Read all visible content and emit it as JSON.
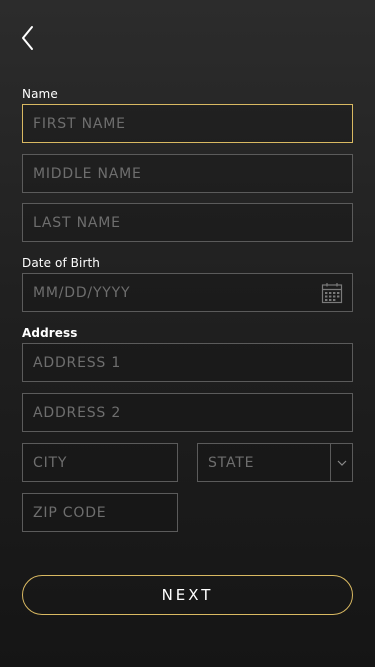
{
  "header": {
    "back_icon": "chevron-left-icon"
  },
  "name_section": {
    "label": "Name",
    "first_name_placeholder": "FIRST NAME",
    "middle_name_placeholder": "MIDDLE NAME",
    "last_name_placeholder": "LAST NAME"
  },
  "dob_section": {
    "label": "Date of Birth",
    "placeholder": "MM/DD/YYYY",
    "icon": "calendar-icon"
  },
  "address_section": {
    "label": "Address",
    "address1_placeholder": "ADDRESS 1",
    "address2_placeholder": "ADDRESS 2",
    "city_placeholder": "CITY",
    "state_placeholder": "STATE",
    "state_icon": "chevron-down-icon",
    "zip_placeholder": "ZIP CODE"
  },
  "footer": {
    "next_label": "NEXT"
  },
  "colors": {
    "accent": "#d9b962",
    "border": "#5b5b5b",
    "placeholder": "#6e6e6e"
  }
}
